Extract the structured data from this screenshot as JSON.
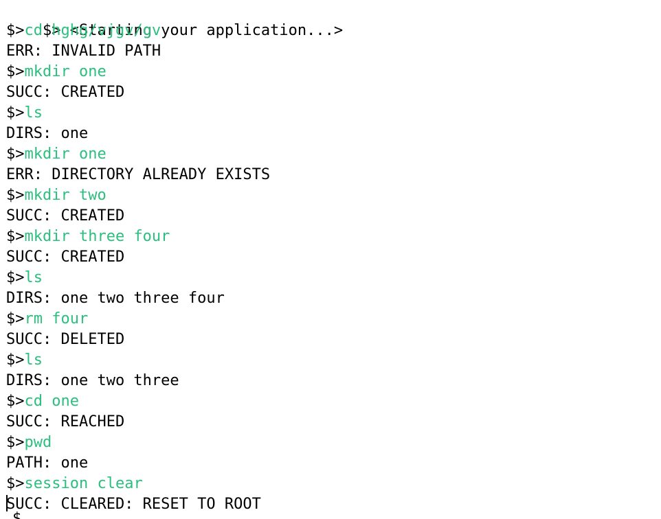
{
  "colors": {
    "background": "#ffffff",
    "text": "#000000",
    "command": "#2bbf7e"
  },
  "terminal": {
    "prompt": "$>",
    "banner": " <Starting your application...>",
    "entries": [
      {
        "command": "cd hghg/vjgv/gv",
        "output": "ERR: INVALID PATH"
      },
      {
        "command": "mkdir one",
        "output": "SUCC: CREATED"
      },
      {
        "command": "ls",
        "output": "DIRS: one"
      },
      {
        "command": "mkdir one",
        "output": "ERR: DIRECTORY ALREADY EXISTS"
      },
      {
        "command": "mkdir two",
        "output": "SUCC: CREATED"
      },
      {
        "command": "mkdir three four",
        "output": "SUCC: CREATED"
      },
      {
        "command": "ls",
        "output": "DIRS: one two three four"
      },
      {
        "command": "rm four",
        "output": "SUCC: DELETED"
      },
      {
        "command": "ls",
        "output": "DIRS: one two three"
      },
      {
        "command": "cd one",
        "output": "SUCC: REACHED"
      },
      {
        "command": "pwd",
        "output": "PATH: one"
      },
      {
        "command": "session clear",
        "output": "SUCC: CLEARED: RESET TO ROOT"
      }
    ],
    "final_prompt": "$"
  }
}
